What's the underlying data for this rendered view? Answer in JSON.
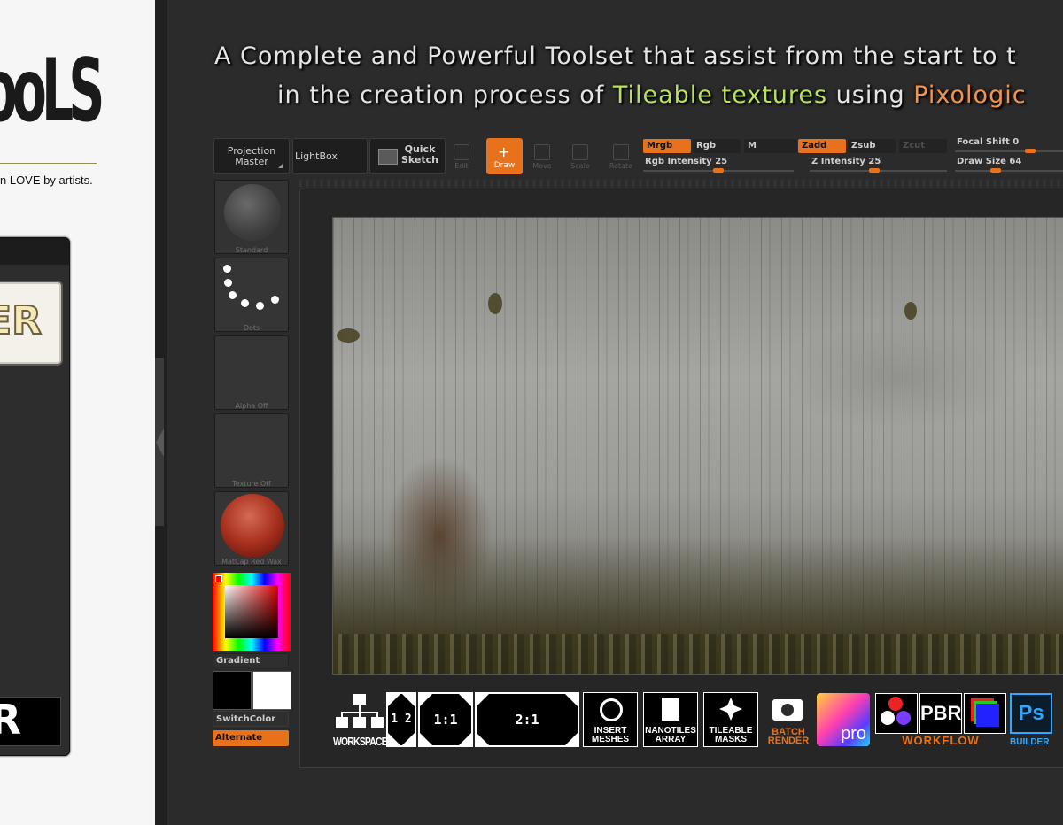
{
  "left_page": {
    "logo_text": "TooLS",
    "tagline": "n LOVE by artists.",
    "widget_button_text": "ER",
    "widget_black_text": "R"
  },
  "headline": {
    "line1": "A Complete and Powerful Toolset that assist from the start to t",
    "line2_prefix": "in the creation process of ",
    "line2_green": "Tileable textures",
    "line2_mid": " using ",
    "line2_orange": "Pixologic"
  },
  "toolbar": {
    "projection_master": "Projection Master",
    "lightbox": "LightBox",
    "quick_sketch": "Quick Sketch",
    "edit": "Edit",
    "draw": "Draw",
    "move": "Move",
    "scale": "Scale",
    "rotate": "Rotate",
    "mrgb": "Mrgb",
    "rgb": "Rgb",
    "m": "M",
    "zadd": "Zadd",
    "zsub": "Zsub",
    "zcut": "Zcut",
    "rgb_intensity_label": "Rgb Intensity",
    "rgb_intensity": 25,
    "z_intensity_label": "Z Intensity",
    "z_intensity": 25,
    "focal_shift_label": "Focal Shift",
    "focal_shift": 0,
    "draw_size_label": "Draw Size",
    "draw_size": 64
  },
  "side_tools": {
    "brush": "Standard",
    "stroke": "Dots",
    "alpha": "Alpha Off",
    "texture": "Texture Off",
    "material": "MatCap Red Wax",
    "gradient": "Gradient",
    "switch_color": "SwitchColor",
    "alternate": "Alternate"
  },
  "bottom_bar": {
    "workspace": "WORKSPACE",
    "half": "1 2",
    "one_one": "1:1",
    "two_one": "2:1",
    "insert_meshes": "INSERT MESHES",
    "nanotiles": "NANOTILES ARRAY",
    "tileable_masks": "TILEABLE MASKS",
    "batch_render": "BATCH RENDER",
    "pro": "pro",
    "pbr": "PBR",
    "workflow": "WORKFLOW",
    "ps": "Ps",
    "builder": "BUILDER"
  },
  "colors": {
    "accent": "#e8721c",
    "green_text": "#b8e05a",
    "orange_text": "#f0944a",
    "panel_bg": "#2b2b2b"
  }
}
